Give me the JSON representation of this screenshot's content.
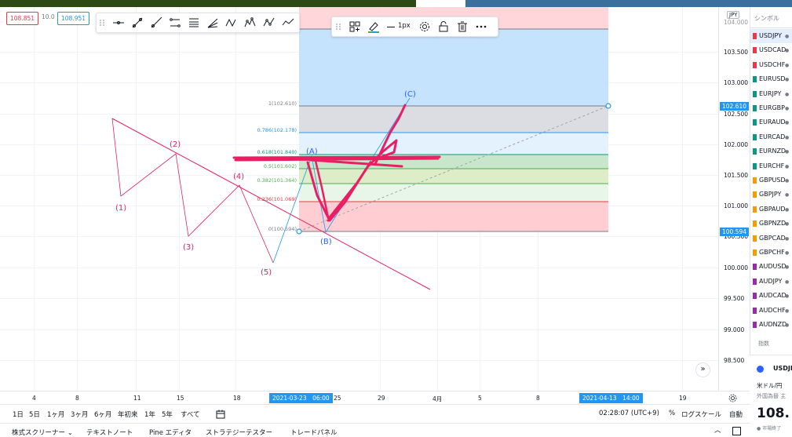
{
  "ohlc": {
    "open": "108.851",
    "spread": "10.0",
    "close": "108.951"
  },
  "price_axis": {
    "currency": "JPY",
    "top_partial": "104.000",
    "ticks": [
      "103.500",
      "103.000",
      "102.500",
      "102.000",
      "101.500",
      "101.000",
      "100.500",
      "100.000",
      "99.500",
      "99.000",
      "98.500"
    ],
    "label_upper": "102.610",
    "label_lower": "100.594"
  },
  "time_axis": {
    "ticks": [
      "4",
      "8",
      "11",
      "15",
      "18",
      "25",
      "29",
      "4月",
      "5",
      "8",
      "5",
      "19"
    ],
    "label_start": "2021-03-23　06:00",
    "label_end": "2021-04-13　14:00"
  },
  "fib_levels": [
    {
      "label": "1(102.610)",
      "color": "#787b86"
    },
    {
      "label": "0.786(102.178)",
      "color": "#2196f3"
    },
    {
      "label": "0.618(101.840)",
      "color": "#089981"
    },
    {
      "label": "0.5(101.602)",
      "color": "#4caf50"
    },
    {
      "label": "0.382(101.364)",
      "color": "#4caf50"
    },
    {
      "label": "0.236(101.069)",
      "color": "#f23645"
    },
    {
      "label": "0(100.594)",
      "color": "#787b86"
    }
  ],
  "wave_labels": {
    "w1": "(1)",
    "w2": "(2)",
    "w3": "(3)",
    "w4": "(4)",
    "w5": "(5)"
  },
  "abc_labels": {
    "a": "(A)",
    "b": "(B)",
    "c": "(C)"
  },
  "fib_toolbar": {
    "width_label": "1px"
  },
  "bottom_toolbar": {
    "ranges": [
      "1日",
      "5日",
      "1ヶ月",
      "3ヶ月",
      "6ヶ月",
      "年初来",
      "1年",
      "5年",
      "すべて"
    ],
    "time": "02:28:07 (UTC+9)",
    "percent": "%",
    "log": "ログスケール",
    "auto": "自動"
  },
  "bottom_tabs": [
    "株式スクリーナー",
    "テキストノート",
    "Pine エディタ",
    "ストラテジーテスター",
    "トレードパネル"
  ],
  "watchlist": {
    "header": "シンボル",
    "items": [
      {
        "symbol": "USDJPY",
        "color": "#f23645",
        "selected": true
      },
      {
        "symbol": "USDCAD",
        "color": "#f23645"
      },
      {
        "symbol": "USDCHF",
        "color": "#f23645"
      },
      {
        "symbol": "EURUSD",
        "color": "#089981"
      },
      {
        "symbol": "EURJPY",
        "color": "#089981"
      },
      {
        "symbol": "EURGBP",
        "color": "#089981"
      },
      {
        "symbol": "EURAUD",
        "color": "#089981"
      },
      {
        "symbol": "EURCAD",
        "color": "#089981"
      },
      {
        "symbol": "EURNZD",
        "color": "#089981"
      },
      {
        "symbol": "EURCHF",
        "color": "#089981"
      },
      {
        "symbol": "GBPUSD",
        "color": "#ff9800"
      },
      {
        "symbol": "GBPJPY",
        "color": "#ff9800"
      },
      {
        "symbol": "GBPAUD",
        "color": "#ff9800"
      },
      {
        "symbol": "GBPNZD",
        "color": "#ff9800"
      },
      {
        "symbol": "GBPCAD",
        "color": "#ff9800"
      },
      {
        "symbol": "GBPCHF",
        "color": "#ff9800"
      },
      {
        "symbol": "AUDUSD",
        "color": "#9c27b0"
      },
      {
        "symbol": "AUDJPY",
        "color": "#9c27b0"
      },
      {
        "symbol": "AUDCAD",
        "color": "#9c27b0"
      },
      {
        "symbol": "AUDCHF",
        "color": "#9c27b0"
      },
      {
        "symbol": "AUDNZD",
        "color": "#9c27b0"
      }
    ],
    "section_label": "指数",
    "detail_symbol": "USDJPY",
    "detail_name": "米ドル/円",
    "detail_type": "外国為替 主",
    "detail_price": "108.",
    "detail_status": "● 市場終了"
  },
  "colors": {
    "accent": "#2196f3",
    "drawing": "#e91e63",
    "wave": "#e0245e"
  }
}
